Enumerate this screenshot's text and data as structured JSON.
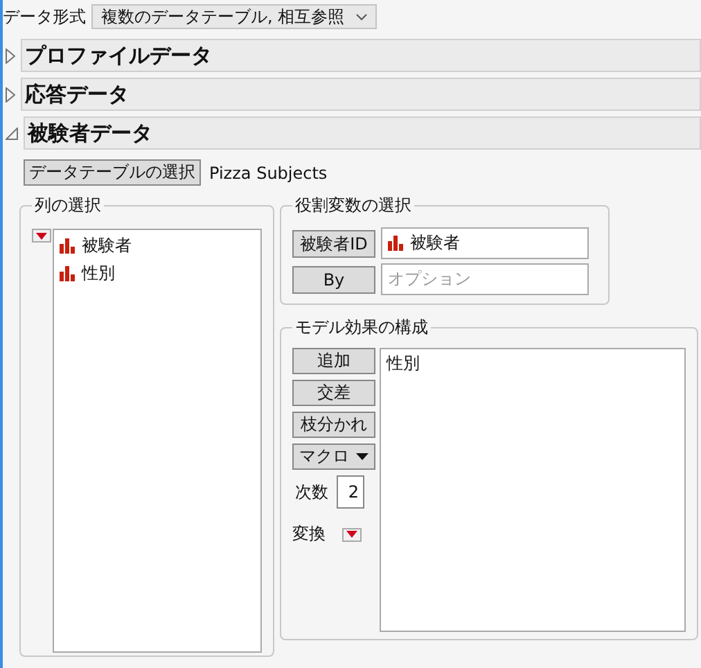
{
  "data_format": {
    "label": "データ形式",
    "value": "複数のデータテーブル, 相互参照"
  },
  "sections": [
    {
      "title": "プロファイルデータ",
      "expanded": false
    },
    {
      "title": "応答データ",
      "expanded": false
    },
    {
      "title": "被験者データ",
      "expanded": true
    }
  ],
  "table_button": "データテーブルの選択",
  "table_name": "Pizza Subjects",
  "column_select": {
    "title": "列の選択",
    "columns": [
      {
        "name": "被験者"
      },
      {
        "name": "性別"
      }
    ]
  },
  "roles": {
    "title": "役割変数の選択",
    "rows": [
      {
        "button": "被験者ID",
        "value": "被験者"
      },
      {
        "button": "By",
        "placeholder": "オプション"
      }
    ]
  },
  "model": {
    "title": "モデル効果の構成",
    "buttons": [
      {
        "label": "追加",
        "kind": "plain"
      },
      {
        "label": "交差",
        "kind": "plain"
      },
      {
        "label": "枝分かれ",
        "kind": "plain"
      },
      {
        "label": "マクロ",
        "kind": "menu"
      }
    ],
    "degree_label": "次数",
    "degree": "2",
    "transform_label": "変換",
    "effects": [
      "性別"
    ]
  }
}
